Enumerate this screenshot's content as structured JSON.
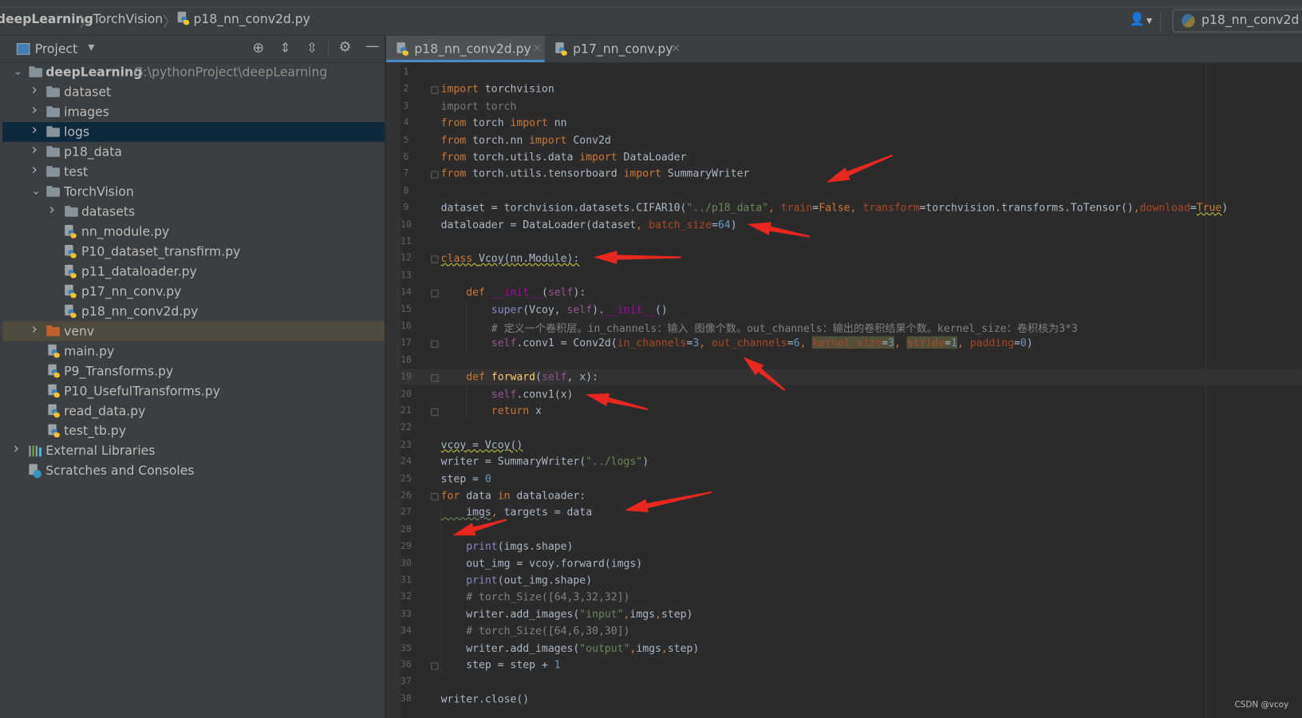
{
  "breadcrumb": [
    "deepLearning",
    "TorchVision",
    "p18_nn_conv2d.py"
  ],
  "run_config": {
    "label": "p18_nn_conv2d",
    "icon": "python-icon"
  },
  "account_icon": "user-icon",
  "project_panel": {
    "title": "Project",
    "toolbar_icons": [
      "locate-icon",
      "expand-all-icon",
      "collapse-all-icon",
      "gear-icon",
      "minimize-icon"
    ]
  },
  "tree": [
    {
      "label": "deepLearning",
      "path": "G:\\pythonProject\\deepLearning",
      "type": "folder",
      "level": 0,
      "expanded": true,
      "bold": true
    },
    {
      "label": "dataset",
      "type": "folder",
      "level": 1
    },
    {
      "label": "images",
      "type": "folder",
      "level": 1
    },
    {
      "label": "logs",
      "type": "folder",
      "level": 1,
      "selected": true
    },
    {
      "label": "p18_data",
      "type": "folder",
      "level": 1
    },
    {
      "label": "test",
      "type": "folder",
      "level": 1
    },
    {
      "label": "TorchVision",
      "type": "folder",
      "level": 1,
      "expanded": true
    },
    {
      "label": "datasets",
      "type": "folder",
      "level": 2
    },
    {
      "label": "nn_module.py",
      "type": "py",
      "level": 2
    },
    {
      "label": "P10_dataset_transfirm.py",
      "type": "py",
      "level": 2
    },
    {
      "label": "p11_dataloader.py",
      "type": "py",
      "level": 2
    },
    {
      "label": "p17_nn_conv.py",
      "type": "py",
      "level": 2
    },
    {
      "label": "p18_nn_conv2d.py",
      "type": "py",
      "level": 2
    },
    {
      "label": "venv",
      "type": "venv",
      "level": 1
    },
    {
      "label": "main.py",
      "type": "py",
      "level": 1
    },
    {
      "label": "P9_Transforms.py",
      "type": "py",
      "level": 1
    },
    {
      "label": "P10_UsefulTransforms.py",
      "type": "py",
      "level": 1
    },
    {
      "label": "read_data.py",
      "type": "py",
      "level": 1
    },
    {
      "label": "test_tb.py",
      "type": "py",
      "level": 1
    },
    {
      "label": "External Libraries",
      "type": "lib",
      "level": 0
    },
    {
      "label": "Scratches and Consoles",
      "type": "scratch",
      "level": 0
    }
  ],
  "tabs": [
    {
      "label": "p18_nn_conv2d.py",
      "active": true
    },
    {
      "label": "p17_nn_conv.py",
      "active": false
    }
  ],
  "editor": {
    "current_line": 19,
    "lines": [
      [],
      [
        [
          "import",
          "kw"
        ],
        [
          " torchvision",
          "tx"
        ]
      ],
      [
        [
          "import torch",
          "dim"
        ]
      ],
      [
        [
          "from",
          "kw"
        ],
        [
          " torch ",
          "tx"
        ],
        [
          "import",
          "kw"
        ],
        [
          " nn",
          "tx"
        ]
      ],
      [
        [
          "from",
          "kw"
        ],
        [
          " torch.nn ",
          "tx"
        ],
        [
          "import",
          "kw"
        ],
        [
          " Conv2d",
          "tx"
        ]
      ],
      [
        [
          "from",
          "kw"
        ],
        [
          " torch.utils.data ",
          "tx"
        ],
        [
          "import",
          "kw"
        ],
        [
          " DataLoader",
          "tx"
        ]
      ],
      [
        [
          "from",
          "kw"
        ],
        [
          " torch.utils.tensorboard ",
          "tx"
        ],
        [
          "import",
          "kw"
        ],
        [
          " SummaryWriter",
          "tx"
        ]
      ],
      [],
      [
        [
          "dataset = torchvision.datasets.CIFAR10(",
          "tx"
        ],
        [
          "\"../p18_data\"",
          "str"
        ],
        [
          ", ",
          "kw"
        ],
        [
          "train",
          "par"
        ],
        [
          "=",
          "tx"
        ],
        [
          "False",
          "kw"
        ],
        [
          ", ",
          "kw"
        ],
        [
          "transform",
          "par"
        ],
        [
          "=torchvision.transforms.ToTensor()",
          "tx"
        ],
        [
          ",",
          "kw"
        ],
        [
          "download",
          "par"
        ],
        [
          "=",
          "tx"
        ],
        [
          "True",
          "kw"
        ],
        [
          ")",
          "tx"
        ]
      ],
      [
        [
          "dataloader = DataLoader(dataset",
          "tx"
        ],
        [
          ", ",
          "kw"
        ],
        [
          "batch_size",
          "par"
        ],
        [
          "=",
          "tx"
        ],
        [
          "64",
          "num"
        ],
        [
          ")",
          "tx"
        ]
      ],
      [],
      [
        [
          "class ",
          "kw"
        ],
        [
          "Vcoy(nn.Module):",
          "tx"
        ]
      ],
      [],
      [
        [
          "    def ",
          "kw"
        ],
        [
          "__init__",
          "dun"
        ],
        [
          "(",
          "tx"
        ],
        [
          "self",
          "self"
        ],
        [
          "):",
          "tx"
        ]
      ],
      [
        [
          "        ",
          "tx"
        ],
        [
          "super",
          "bi"
        ],
        [
          "(Vcoy, ",
          "tx"
        ],
        [
          "self",
          "self"
        ],
        [
          ").",
          "tx"
        ],
        [
          "__init__",
          "dun"
        ],
        [
          "()",
          "tx"
        ]
      ],
      [
        [
          "        # 定义一个卷积层。in_channels：输入 图像个数。out_channels：输出的卷积结果个数。kernel_size：卷积核为3*3",
          "cm"
        ]
      ],
      [
        [
          "        ",
          "tx"
        ],
        [
          "self",
          "self"
        ],
        [
          ".conv1 = Conv2d(",
          "tx"
        ],
        [
          "in_channels",
          "par"
        ],
        [
          "=",
          "tx"
        ],
        [
          "3",
          "num"
        ],
        [
          ", ",
          "kw"
        ],
        [
          "out_channels",
          "par"
        ],
        [
          "=",
          "tx"
        ],
        [
          "6",
          "num"
        ],
        [
          ", ",
          "kw"
        ],
        [
          "kernel_size",
          "par"
        ],
        [
          "=",
          "tx"
        ],
        [
          "3",
          "num"
        ],
        [
          ", ",
          "kw"
        ],
        [
          "stride",
          "par"
        ],
        [
          "=",
          "tx"
        ],
        [
          "1",
          "num"
        ],
        [
          ", ",
          "kw"
        ],
        [
          "padding",
          "par"
        ],
        [
          "=",
          "tx"
        ],
        [
          "0",
          "num"
        ],
        [
          ")",
          "tx"
        ]
      ],
      [],
      [
        [
          "    def ",
          "kw"
        ],
        [
          "forward",
          "fn"
        ],
        [
          "(",
          "tx"
        ],
        [
          "self",
          "self"
        ],
        [
          ", x):",
          "tx"
        ]
      ],
      [
        [
          "        ",
          "tx"
        ],
        [
          "self",
          "self"
        ],
        [
          ".conv1(x)",
          "tx"
        ]
      ],
      [
        [
          "        return ",
          "kw"
        ],
        [
          "x",
          "tx"
        ]
      ],
      [],
      [
        [
          "vcoy = Vcoy()",
          "tx"
        ]
      ],
      [
        [
          "writer = SummaryWriter(",
          "tx"
        ],
        [
          "\"../logs\"",
          "str"
        ],
        [
          ")",
          "tx"
        ]
      ],
      [
        [
          "step = ",
          "tx"
        ],
        [
          "0",
          "num"
        ]
      ],
      [
        [
          "for ",
          "kw"
        ],
        [
          "data ",
          "tx"
        ],
        [
          "in ",
          "kw"
        ],
        [
          "dataloader:",
          "tx"
        ]
      ],
      [
        [
          "    imgs",
          "tx"
        ],
        [
          ", ",
          "kw"
        ],
        [
          "targets = data",
          "tx"
        ]
      ],
      [],
      [
        [
          "    ",
          "tx"
        ],
        [
          "print",
          "bi"
        ],
        [
          "(imgs.shape)",
          "tx"
        ]
      ],
      [
        [
          "    out_img = vcoy.forward(imgs)",
          "tx"
        ]
      ],
      [
        [
          "    ",
          "tx"
        ],
        [
          "print",
          "bi"
        ],
        [
          "(out_img.shape)",
          "tx"
        ]
      ],
      [
        [
          "    # torch_Size([64,3,32,32])",
          "cm"
        ]
      ],
      [
        [
          "    writer.add_images(",
          "tx"
        ],
        [
          "\"input\"",
          "str"
        ],
        [
          ",",
          "kw"
        ],
        [
          "imgs",
          "tx"
        ],
        [
          ",",
          "kw"
        ],
        [
          "step)",
          "tx"
        ]
      ],
      [
        [
          "    # torch_Size([64,6,30,30])",
          "cm"
        ]
      ],
      [
        [
          "    writer.add_images(",
          "tx"
        ],
        [
          "\"output\"",
          "str"
        ],
        [
          ",",
          "kw"
        ],
        [
          "imgs",
          "tx"
        ],
        [
          ",",
          "kw"
        ],
        [
          "step)",
          "tx"
        ]
      ],
      [
        [
          "    step = step + ",
          "tx"
        ],
        [
          "1",
          "num"
        ]
      ],
      [],
      [
        [
          "writer.close()",
          "tx"
        ]
      ]
    ]
  },
  "annotation_color": "#e8281e",
  "watermark": "CSDN @vcoy"
}
